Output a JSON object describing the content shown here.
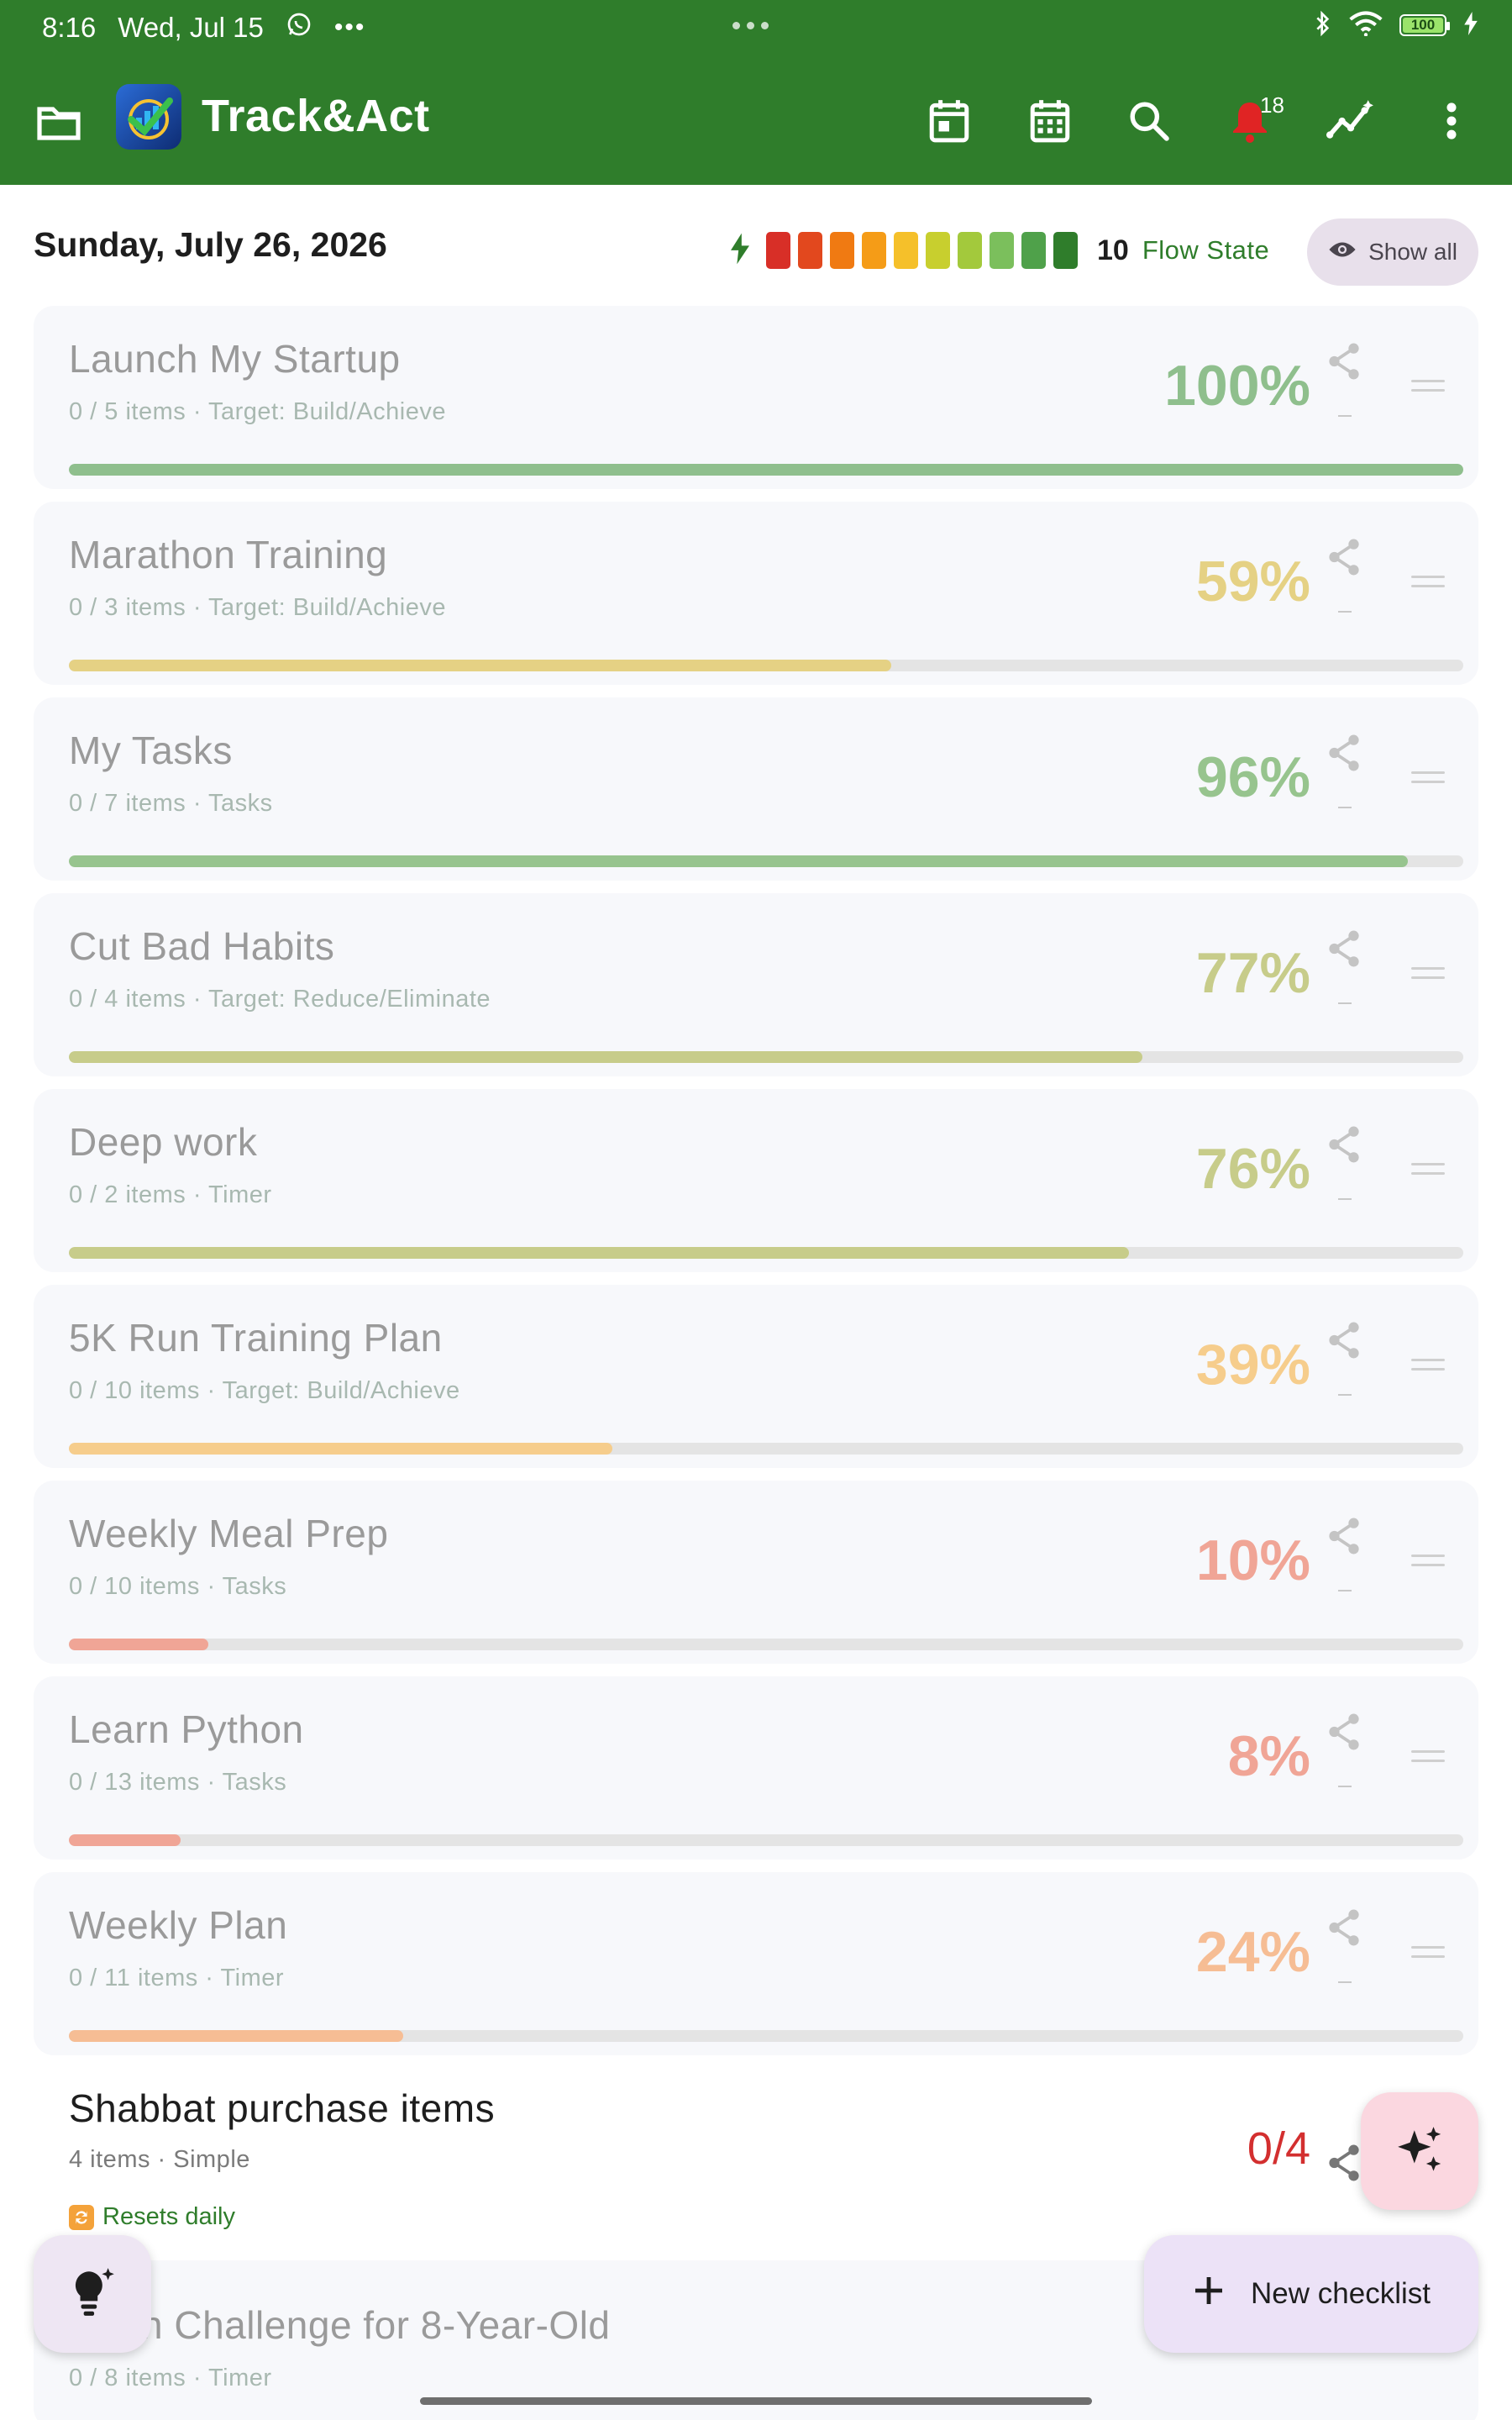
{
  "status_bar": {
    "time": "8:16",
    "date": "Wed, Jul 15",
    "battery": "100"
  },
  "app_bar": {
    "title": "Track&Act",
    "notification_count": "18"
  },
  "header": {
    "date": "Sunday, July 26, 2026",
    "flow_value": "10",
    "flow_label": "Flow State",
    "show_all_label": "Show all",
    "flow_colors": [
      "#d82f27",
      "#e2481e",
      "#f07a12",
      "#f59c17",
      "#f5c02a",
      "#c8cf2e",
      "#a3c93c",
      "#7bbf5c",
      "#4fa14a",
      "#2f7d2b"
    ]
  },
  "cards": [
    {
      "title": "Launch My Startup",
      "sub": "0 / 5 items · Target: Build/Achieve",
      "percent": "100%",
      "progress": 1.0,
      "color": "#8fbf8d"
    },
    {
      "title": "Marathon Training",
      "sub": "0 / 3 items · Target: Build/Achieve",
      "percent": "59%",
      "progress": 0.59,
      "color": "#e5d184"
    },
    {
      "title": "My Tasks",
      "sub": "0 / 7 items · Tasks",
      "percent": "96%",
      "progress": 0.96,
      "color": "#97c48e"
    },
    {
      "title": "Cut Bad Habits",
      "sub": "0 / 4 items · Target: Reduce/Eliminate",
      "percent": "77%",
      "progress": 0.77,
      "color": "#c7cc8a"
    },
    {
      "title": "Deep work",
      "sub": "0 / 2 items · Timer",
      "percent": "76%",
      "progress": 0.76,
      "color": "#c7cc8a"
    },
    {
      "title": "5K Run Training Plan",
      "sub": "0 / 10 items · Target: Build/Achieve",
      "percent": "39%",
      "progress": 0.39,
      "color": "#f6cd8c"
    },
    {
      "title": "Weekly Meal Prep",
      "sub": "0 / 10 items · Tasks",
      "percent": "10%",
      "progress": 0.1,
      "color": "#f0a596"
    },
    {
      "title": "Learn Python",
      "sub": "0 / 13 items · Tasks",
      "percent": "8%",
      "progress": 0.08,
      "color": "#f0a596"
    },
    {
      "title": "Weekly Plan",
      "sub": "0 / 11 items · Timer",
      "percent": "24%",
      "progress": 0.24,
      "color": "#f6bd94"
    }
  ],
  "active_card": {
    "title": "Shabbat purchase items",
    "sub": "4 items · Simple",
    "count": "0/4",
    "reset_label": "Resets daily",
    "count_color": "#d32f2f"
  },
  "partial_card": {
    "title": "n Challenge for 8-Year-Old",
    "sub": "0 / 8 items · Timer"
  },
  "fab": {
    "new_checklist": "New checklist"
  }
}
